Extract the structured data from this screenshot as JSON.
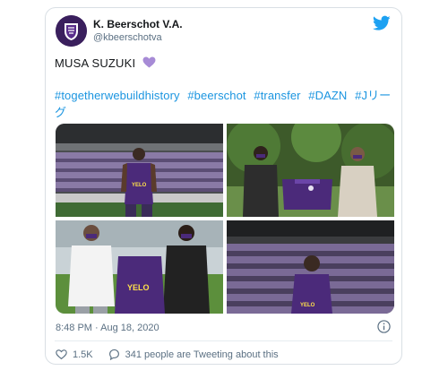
{
  "tweet": {
    "account_name": "K. Beerschot V.A.",
    "handle": "@kbeerschotva",
    "text": "MUSA SUZUKI",
    "hashtags": [
      "#togetherwebuildhistory",
      "#beerschot",
      "#transfer",
      "#DAZN",
      "#Jリーグ"
    ],
    "timestamp": "8:48 PM · Aug 18, 2020",
    "like_count": "1.5K",
    "conversation_text": "341 people are Tweeting about this",
    "jersey_sponsor": "YELO"
  },
  "colors": {
    "link": "#1b95e0",
    "twitter_blue": "#1da1f2",
    "heart_purple": "#a78bd6",
    "club_purple": "#4b2a7a"
  },
  "icons": [
    "avatar-club-logo",
    "twitter-bird-icon",
    "purple-heart-icon",
    "info-icon",
    "heart-icon",
    "reply-icon"
  ]
}
